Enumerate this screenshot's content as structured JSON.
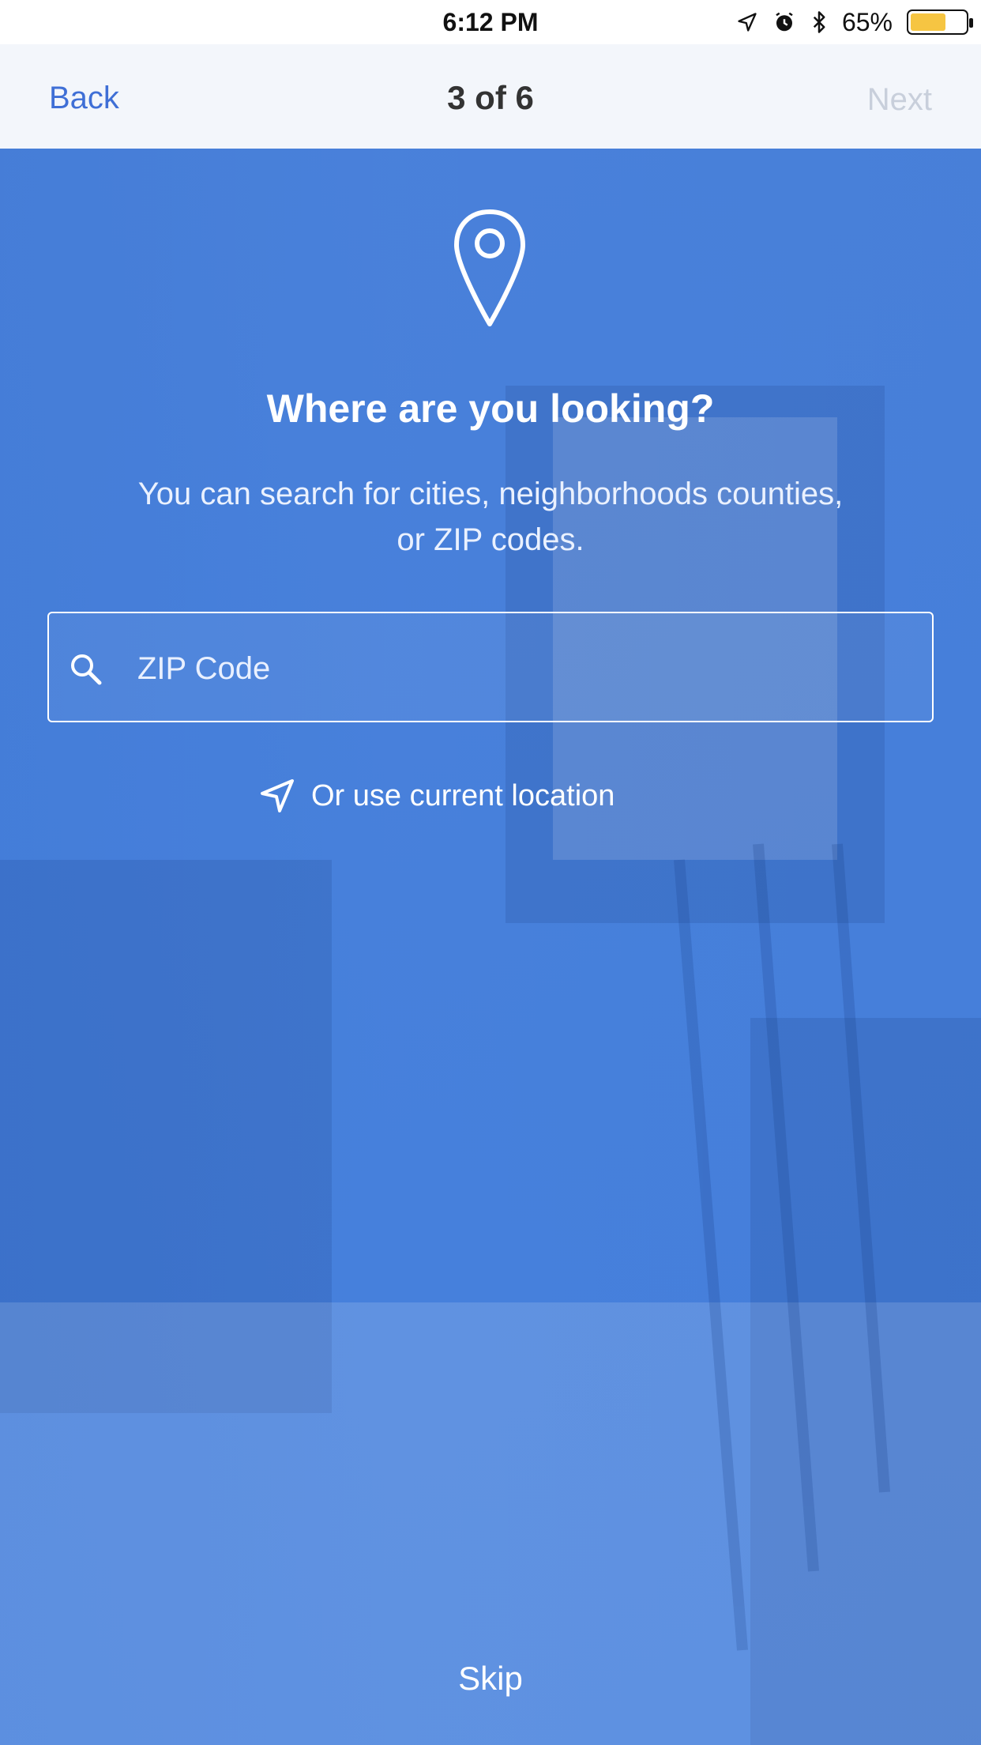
{
  "status_bar": {
    "time": "6:12 PM",
    "battery_percent": "65%",
    "battery_level": 0.65,
    "icons": [
      "location-arrow-icon",
      "alarm-icon",
      "bluetooth-icon",
      "battery-icon"
    ]
  },
  "nav": {
    "back_label": "Back",
    "step_label": "3 of 6",
    "next_label": "Next"
  },
  "hero": {
    "icon": "map-pin-icon",
    "title": "Where are you looking?",
    "subtitle": "You can search for cities, neighborhoods counties, or ZIP codes."
  },
  "search": {
    "icon": "search-icon",
    "placeholder": "ZIP Code",
    "value": ""
  },
  "location": {
    "icon": "location-arrow-icon",
    "label": "Or use current location"
  },
  "footer": {
    "skip_label": "Skip"
  },
  "colors": {
    "accent": "#3f6fd6",
    "overlay": "#3a78dc",
    "battery": "#f6c542"
  }
}
